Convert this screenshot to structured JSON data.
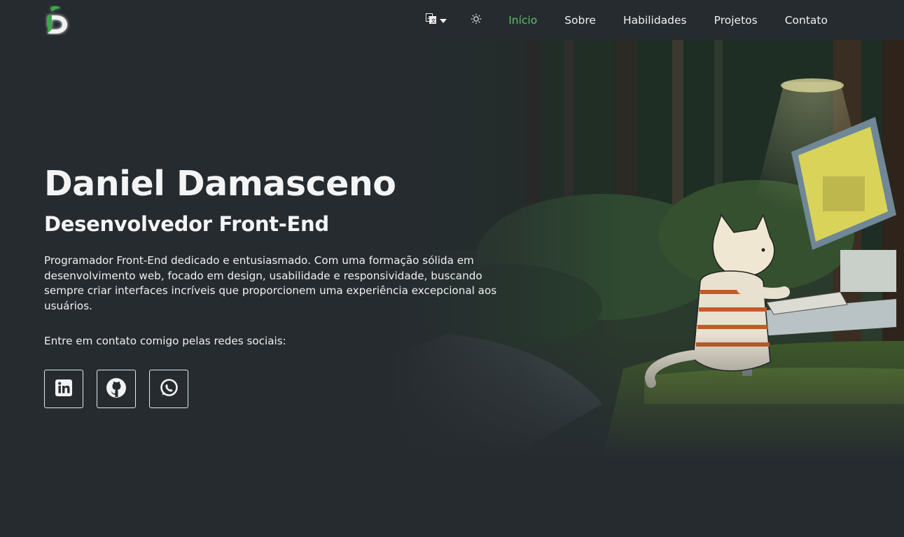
{
  "header": {
    "logo_letter": "D",
    "language_icon": "translate-icon",
    "theme_icon": "sun-icon",
    "nav": [
      {
        "label": "Início",
        "active": true
      },
      {
        "label": "Sobre",
        "active": false
      },
      {
        "label": "Habilidades",
        "active": false
      },
      {
        "label": "Projetos",
        "active": false
      },
      {
        "label": "Contato",
        "active": false
      }
    ]
  },
  "hero": {
    "name": "Daniel Damasceno",
    "role": "Desenvolvedor Front-End",
    "description": "Programador Front-End dedicado e entusiasmado. Com uma formação sólida em desenvolvimento web, focado em design, usabilidade e responsividade, buscando sempre criar interfaces incríveis que proporcionem uma experiência excepcional aos usuários.",
    "contact_text": "Entre em contato comigo pelas redes sociais:",
    "socials": [
      {
        "icon": "linkedin-icon"
      },
      {
        "icon": "github-icon"
      },
      {
        "icon": "whatsapp-icon"
      }
    ]
  },
  "colors": {
    "background": "#262b30",
    "accent": "#5fbf68",
    "text": "#f4f4f4"
  }
}
